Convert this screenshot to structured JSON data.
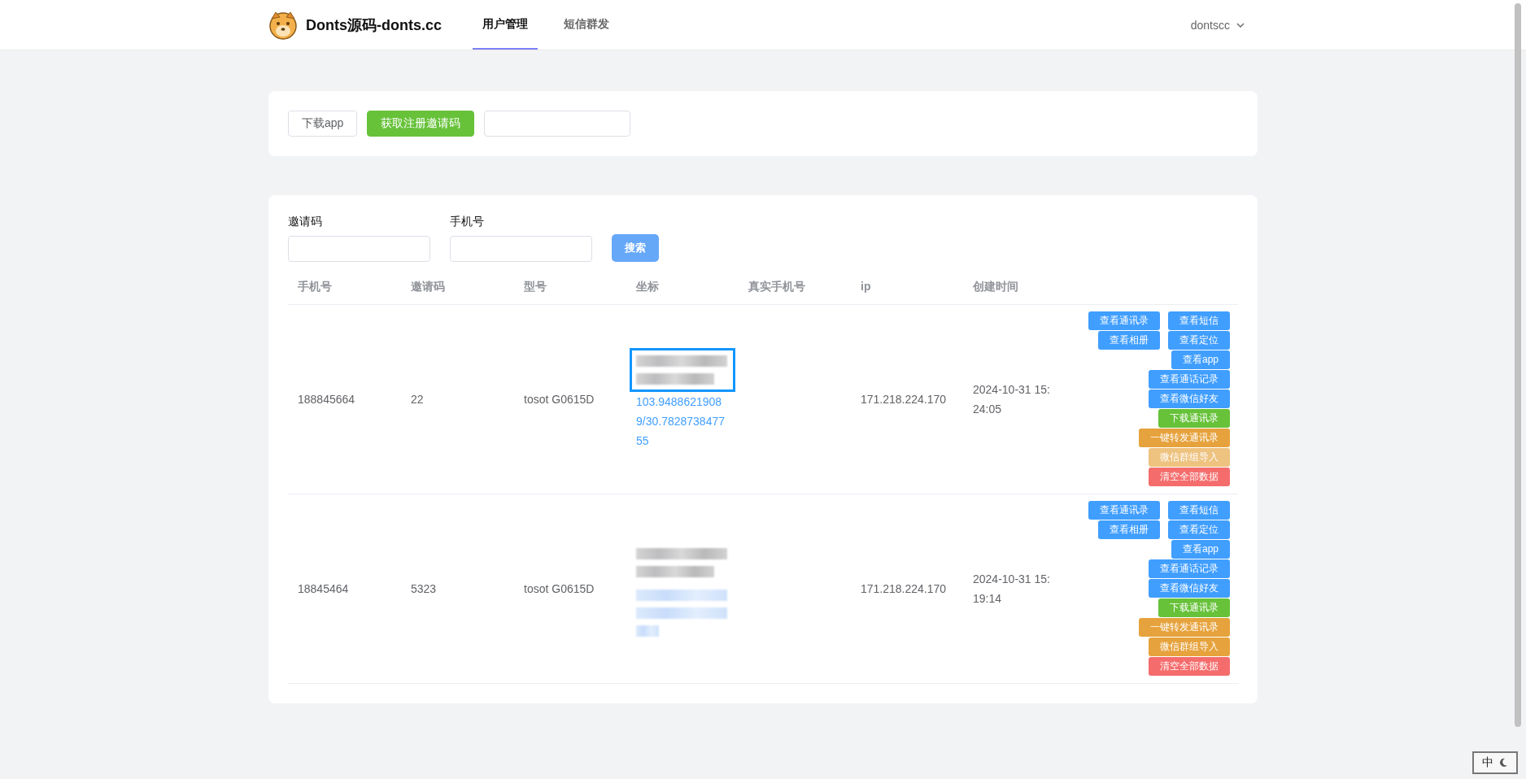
{
  "header": {
    "brand": "Donts源码-donts.cc",
    "nav": [
      {
        "label": "用户管理",
        "selected": true
      },
      {
        "label": "短信群发",
        "selected": false
      }
    ],
    "user": "dontscc"
  },
  "toolbar": {
    "buttons": [
      {
        "label": "下载app",
        "kind": "default"
      },
      {
        "label": "获取注册邀请码",
        "kind": "success"
      }
    ],
    "code_field": {
      "kind": "text"
    }
  },
  "filters": {
    "fields": [
      {
        "label": "邀请码"
      },
      {
        "label": "手机号"
      }
    ],
    "search_button": "搜索"
  },
  "table": {
    "columns": [
      "手机号",
      "邀请码",
      "型号",
      "坐标",
      "真实手机号",
      "ip",
      "创建时间"
    ],
    "rows": [
      {
        "phone": "188845664",
        "invite_code": "22",
        "model": "tosot G0615D",
        "address_redacted": true,
        "coordinates_redacted": false,
        "coordinates": "103.94886219089/30.782873847755",
        "focused": true,
        "ip": "171.218.224.170",
        "created": "2024-10-31 15:24:05",
        "actions": [
          {
            "label": "查看通讯录",
            "kind": "primary",
            "disabled": false
          },
          {
            "label": "查看短信",
            "kind": "primary",
            "disabled": false
          },
          {
            "label": "查看相册",
            "kind": "primary",
            "disabled": false
          },
          {
            "label": "查看定位",
            "kind": "primary",
            "disabled": false
          },
          {
            "label": "查看app",
            "kind": "primary",
            "disabled": false
          },
          {
            "label": "查看通话记录",
            "kind": "primary",
            "disabled": false
          },
          {
            "label": "查看微信好友",
            "kind": "primary",
            "disabled": false
          },
          {
            "label": "下载通讯录",
            "kind": "success",
            "disabled": false
          },
          {
            "label": "一键转发通讯录",
            "kind": "warning",
            "disabled": false
          },
          {
            "label": "微信群组导入",
            "kind": "warning",
            "disabled": true
          },
          {
            "label": "清空全部数据",
            "kind": "danger",
            "disabled": false
          }
        ]
      },
      {
        "phone": "18845464",
        "invite_code": "5323",
        "model": "tosot G0615D",
        "address_redacted": true,
        "coordinates_redacted": true,
        "focused": false,
        "ip": "171.218.224.170",
        "created": "2024-10-31 15:19:14",
        "actions": [
          {
            "label": "查看通讯录",
            "kind": "primary",
            "disabled": false
          },
          {
            "label": "查看短信",
            "kind": "primary",
            "disabled": false
          },
          {
            "label": "查看相册",
            "kind": "primary",
            "disabled": false
          },
          {
            "label": "查看定位",
            "kind": "primary",
            "disabled": false
          },
          {
            "label": "查看app",
            "kind": "primary",
            "disabled": false
          },
          {
            "label": "查看通话记录",
            "kind": "primary",
            "disabled": false
          },
          {
            "label": "查看微信好友",
            "kind": "primary",
            "disabled": false
          },
          {
            "label": "下载通讯录",
            "kind": "success",
            "disabled": false
          },
          {
            "label": "一键转发通讯录",
            "kind": "warning",
            "disabled": false
          },
          {
            "label": "微信群组导入",
            "kind": "warning",
            "disabled": false
          },
          {
            "label": "清空全部数据",
            "kind": "danger",
            "disabled": false
          }
        ]
      }
    ]
  },
  "ime": {
    "label": "中"
  }
}
